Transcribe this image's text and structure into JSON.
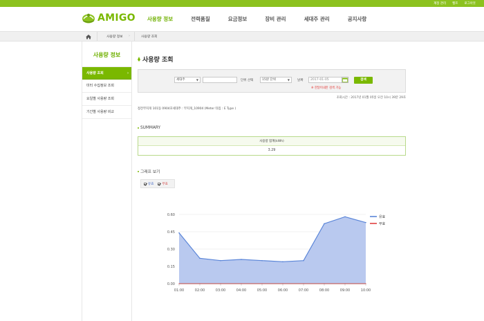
{
  "top_links": [
    "계정 관리",
    "헬프",
    "로그아웃"
  ],
  "brand": {
    "name": "AMIGO",
    "accent": "#7ab800",
    "topbar": "#8cc21f"
  },
  "gnb": [
    {
      "label": "사용량 정보",
      "active": true
    },
    {
      "label": "전력품질",
      "active": false
    },
    {
      "label": "요금정보",
      "active": false
    },
    {
      "label": "장비 관리",
      "active": false
    },
    {
      "label": "세대주 관리",
      "active": false
    },
    {
      "label": "공지사항",
      "active": false
    }
  ],
  "breadcrumb": {
    "home_icon": "home-icon",
    "level1": "사용량 정보",
    "level2": "사용량 조회"
  },
  "sidebar": {
    "title": "사용량 정보",
    "items": [
      {
        "label": "사용량 조회",
        "active": true
      },
      {
        "label": "미터 수집정보 조회",
        "active": false
      },
      {
        "label": "요일별 사용량 조회",
        "active": false
      },
      {
        "label": "기간별 사용량 비교",
        "active": false
      }
    ]
  },
  "page": {
    "title": "사용량 조회"
  },
  "search": {
    "select1": "세대주",
    "input1": "",
    "unit_label": "단위 선택",
    "unit_value": "15분 단위",
    "date_label": "날짜",
    "date_value": "2017-01-05",
    "button": "검색",
    "warning": "※ 한달이내만 검색 가능"
  },
  "query_time": "조회시간 : 2017년 01월 05일 오전 10시 39분 29초",
  "meter_info": "정전무지개 101동 0904호세대주 : 무지개_10904 (Meter 타입 : E Type )",
  "summary": {
    "title": "SUMMARY",
    "header": "사용량 합계(kWh)",
    "value": "3.29"
  },
  "graph": {
    "title": "그래프 보기",
    "legend_effective": "유효",
    "legend_reactive": "무효"
  },
  "chart_data": {
    "type": "area",
    "x": [
      "01:00",
      "02:00",
      "03:00",
      "04:00",
      "05:00",
      "06:00",
      "07:00",
      "08:00",
      "09:00",
      "10:00"
    ],
    "series": [
      {
        "name": "유효",
        "values": [
          0.44,
          0.22,
          0.2,
          0.21,
          0.2,
          0.19,
          0.2,
          0.52,
          0.58,
          0.53
        ],
        "color": "#5a85d8"
      },
      {
        "name": "무효",
        "values": [
          0,
          0,
          0,
          0,
          0,
          0,
          0,
          0,
          0,
          0
        ],
        "color": "#e04040"
      }
    ],
    "yticks": [
      "0.60",
      "0.45",
      "0.30",
      "0.15",
      "0.00"
    ],
    "ylim": [
      0,
      0.6
    ],
    "grid": true,
    "legend_position": "top-right"
  }
}
